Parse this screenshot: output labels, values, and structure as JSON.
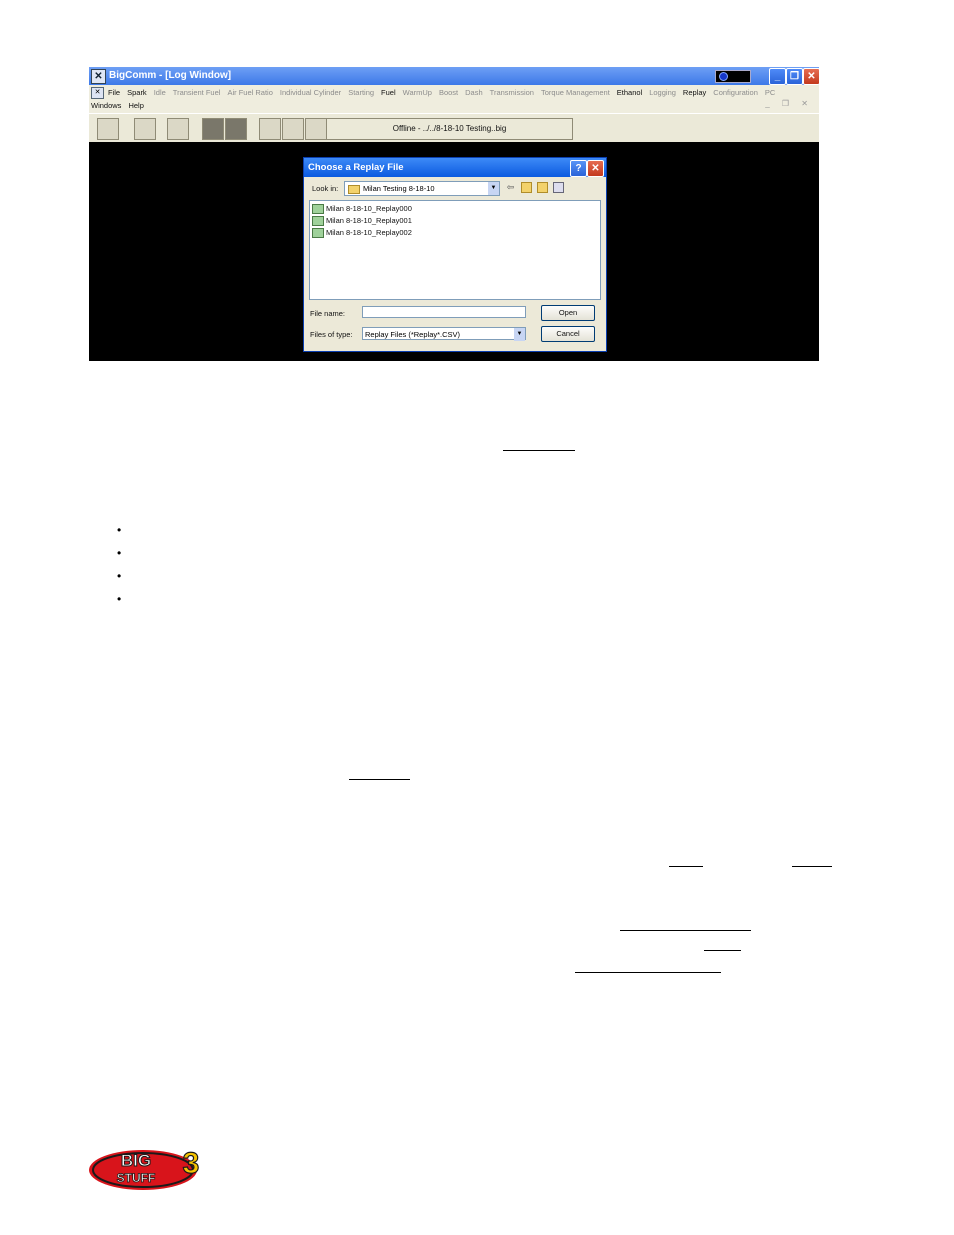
{
  "app_window": {
    "title": "BigComm - [Log Window]",
    "menu_row1": [
      {
        "label": "File",
        "enabled": true
      },
      {
        "label": "Spark",
        "enabled": true
      },
      {
        "label": "Idle",
        "enabled": false
      },
      {
        "label": "Transient Fuel",
        "enabled": false
      },
      {
        "label": "Air Fuel Ratio",
        "enabled": false
      },
      {
        "label": "Individual Cylinder",
        "enabled": false
      },
      {
        "label": "Starting",
        "enabled": false
      },
      {
        "label": "Fuel",
        "enabled": true
      },
      {
        "label": "WarmUp",
        "enabled": false
      },
      {
        "label": "Boost",
        "enabled": false
      },
      {
        "label": "Dash",
        "enabled": false
      },
      {
        "label": "Transmission",
        "enabled": false
      },
      {
        "label": "Torque Management",
        "enabled": false
      },
      {
        "label": "Ethanol",
        "enabled": true
      },
      {
        "label": "Logging",
        "enabled": false
      },
      {
        "label": "Replay",
        "enabled": true
      },
      {
        "label": "Configuration",
        "enabled": false
      },
      {
        "label": "PC",
        "enabled": false
      }
    ],
    "menu_row2": [
      {
        "label": "Windows",
        "enabled": true
      },
      {
        "label": "Help",
        "enabled": true
      }
    ],
    "toolbar_status": "Offline - ../../8-18-10 Testing..big"
  },
  "dialog": {
    "title": "Choose a Replay File",
    "look_in_label": "Look in:",
    "look_in_value": "Milan Testing 8-18-10",
    "files": [
      "Milan 8-18-10_Replay000",
      "Milan 8-18-10_Replay001",
      "Milan 8-18-10_Replay002"
    ],
    "file_name_label": "File name:",
    "file_name_value": "",
    "files_of_type_label": "Files of type:",
    "files_of_type_value": "Replay Files (*Replay*.CSV)",
    "open_label": "Open",
    "cancel_label": "Cancel"
  },
  "icons": {
    "back": "back-arrow-icon",
    "up": "up-folder-icon",
    "new_folder": "new-folder-icon",
    "view": "view-menu-icon",
    "help": "help-icon",
    "close": "close-icon"
  },
  "logo": {
    "text_top": "BIG",
    "text_bottom": "STUFF",
    "number": "3"
  },
  "colors": {
    "xp_title": "#0b5ae0",
    "logo_red": "#d8141b",
    "logo_yellow": "#f5c400"
  }
}
